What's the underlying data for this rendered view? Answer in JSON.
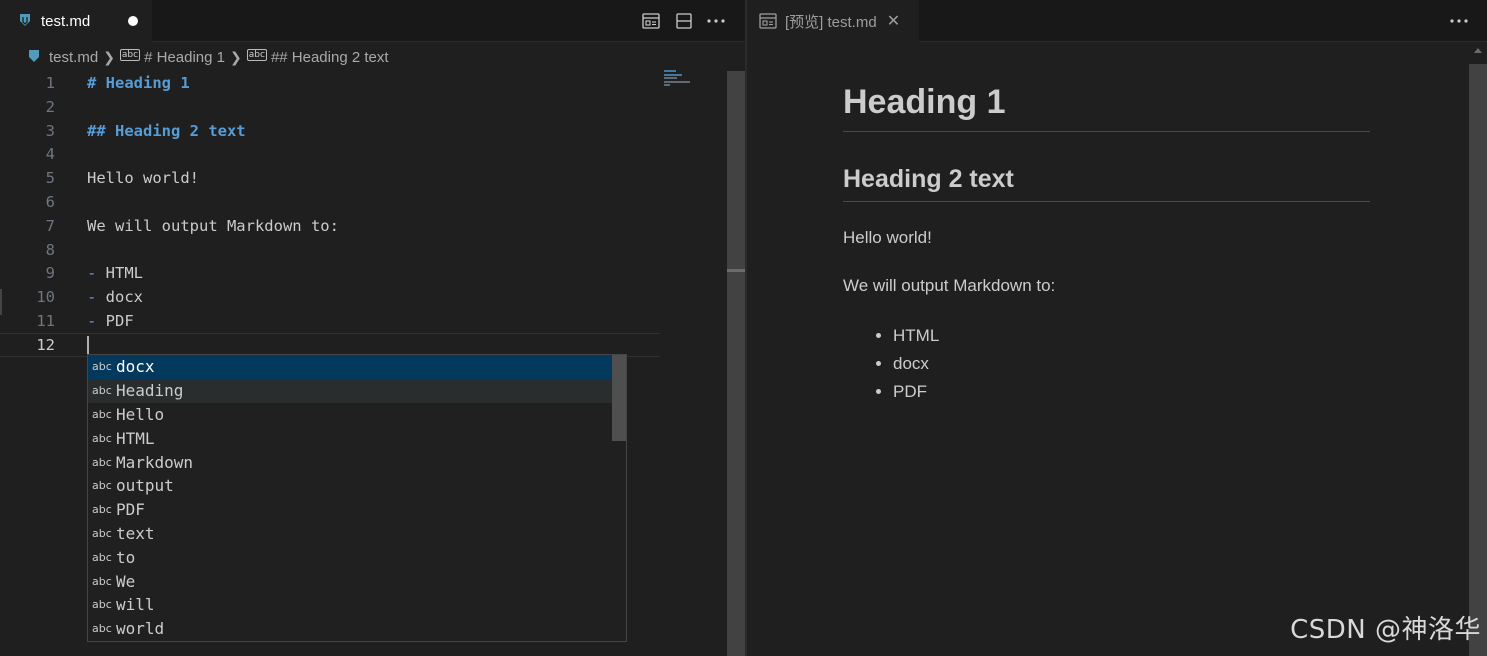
{
  "left_editor": {
    "tab": {
      "filename": "test.md",
      "dirty": true
    },
    "toolbar_icons": [
      "open-preview-icon",
      "split-editor-icon",
      "more-actions-icon"
    ],
    "breadcrumb": {
      "file": "test.md",
      "symbol1": "# Heading 1",
      "symbol2": "## Heading 2 text"
    },
    "lines": [
      {
        "num": "1",
        "text": "# Heading 1",
        "kind": "heading"
      },
      {
        "num": "2",
        "text": "",
        "kind": "plain"
      },
      {
        "num": "3",
        "text": "## Heading 2 text",
        "kind": "heading"
      },
      {
        "num": "4",
        "text": "",
        "kind": "plain"
      },
      {
        "num": "5",
        "text": "Hello world!",
        "kind": "plain"
      },
      {
        "num": "6",
        "text": "",
        "kind": "plain"
      },
      {
        "num": "7",
        "text": "We will output Markdown to:",
        "kind": "plain"
      },
      {
        "num": "8",
        "text": "",
        "kind": "plain"
      },
      {
        "num": "9",
        "bullet": "-",
        "text": " HTML",
        "kind": "list"
      },
      {
        "num": "10",
        "bullet": "-",
        "text": " docx",
        "kind": "list"
      },
      {
        "num": "11",
        "bullet": "-",
        "text": " PDF",
        "kind": "list"
      },
      {
        "num": "12",
        "text": "",
        "kind": "current"
      }
    ],
    "suggestions": {
      "kind_label": "abc",
      "items": [
        "docx",
        "Heading",
        "Hello",
        "HTML",
        "Markdown",
        "output",
        "PDF",
        "text",
        "to",
        "We",
        "will",
        "world"
      ],
      "selected": "docx",
      "hovered": "Heading"
    }
  },
  "right_preview": {
    "tab": {
      "title": "[预览] test.md"
    },
    "h1": "Heading 1",
    "h2": "Heading 2 text",
    "p1": "Hello world!",
    "p2": "We will output Markdown to:",
    "list": [
      "HTML",
      "docx",
      "PDF"
    ]
  },
  "watermark": "CSDN @神洛华",
  "colors": {
    "heading_blue": "#569cd6",
    "selection": "#04395e",
    "background": "#1f1f1f"
  }
}
